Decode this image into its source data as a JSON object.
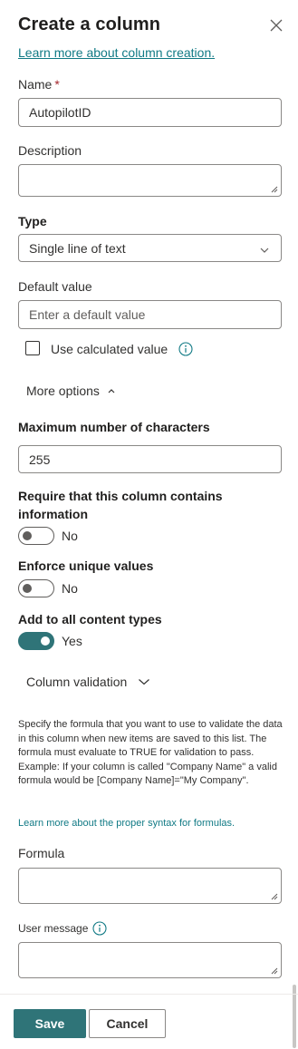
{
  "panel": {
    "title": "Create a column",
    "learn_more": "Learn more about column creation."
  },
  "name": {
    "label": "Name",
    "required_mark": "*",
    "value": "AutopilotID"
  },
  "description": {
    "label": "Description",
    "value": ""
  },
  "type": {
    "label": "Type",
    "selected": "Single line of text"
  },
  "default_value": {
    "label": "Default value",
    "placeholder": "Enter a default value"
  },
  "calculated": {
    "label": "Use calculated value",
    "checked": false
  },
  "more_options": {
    "label": "More options"
  },
  "max_chars": {
    "label": "Maximum number of characters",
    "value": "255"
  },
  "require_info": {
    "label_line1": "Require that this column contains",
    "label_line2": "information",
    "state": "No"
  },
  "enforce_unique": {
    "label": "Enforce unique values",
    "state": "No"
  },
  "add_all": {
    "label": "Add to all content types",
    "state": "Yes"
  },
  "column_validation": {
    "label": "Column validation",
    "description": "Specify the formula that you want to use to validate the data in this column when new items are saved to this list. The formula must evaluate to TRUE for validation to pass. Example: If your column is called \"Company Name\" a valid formula would be [Company Name]=\"My Company\".",
    "syntax_link": "Learn more about the proper syntax for formulas."
  },
  "formula": {
    "label": "Formula",
    "value": ""
  },
  "user_message": {
    "label": "User message",
    "value": ""
  },
  "footer": {
    "save": "Save",
    "cancel": "Cancel"
  },
  "colors": {
    "accent": "#2f7478",
    "link": "#117a85",
    "required": "#a4262c"
  }
}
